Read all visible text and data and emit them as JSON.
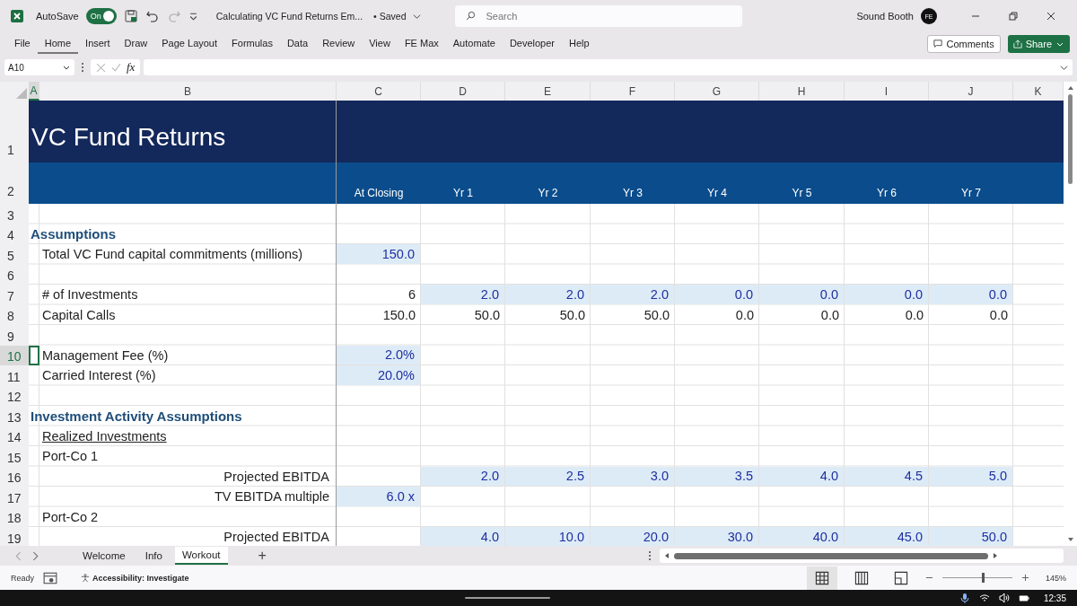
{
  "title_bar": {
    "autosave_label": "AutoSave",
    "autosave": {
      "on": true,
      "label": "On"
    },
    "document_title": "Calculating VC Fund Returns Em...",
    "save_status": "• Saved",
    "search": {
      "placeholder": "Search"
    },
    "user_name": "Sound Booth",
    "avatar_initials": "FE"
  },
  "ribbon_tabs": [
    {
      "label": "File",
      "selected": false
    },
    {
      "label": "Home",
      "selected": true
    },
    {
      "label": "Insert",
      "selected": false
    },
    {
      "label": "Draw",
      "selected": false
    },
    {
      "label": "Page Layout",
      "selected": false
    },
    {
      "label": "Formulas",
      "selected": false
    },
    {
      "label": "Data",
      "selected": false
    },
    {
      "label": "Review",
      "selected": false
    },
    {
      "label": "View",
      "selected": false
    },
    {
      "label": "FE Max",
      "selected": false
    },
    {
      "label": "Automate",
      "selected": false
    },
    {
      "label": "Developer",
      "selected": false
    },
    {
      "label": "Help",
      "selected": false
    }
  ],
  "comments_button": "Comments",
  "share_button": "Share",
  "formula_bar": {
    "name_box": "A10",
    "fx": "fx"
  },
  "sheet": {
    "columns": [
      {
        "label": "A",
        "selected": true
      },
      {
        "label": "B",
        "selected": false
      },
      {
        "label": "C",
        "selected": false
      },
      {
        "label": "D",
        "selected": false
      },
      {
        "label": "E",
        "selected": false
      },
      {
        "label": "F",
        "selected": false
      },
      {
        "label": "G",
        "selected": false
      },
      {
        "label": "H",
        "selected": false
      },
      {
        "label": "I",
        "selected": false
      },
      {
        "label": "J",
        "selected": false
      },
      {
        "label": "K",
        "selected": false
      }
    ],
    "rows": [
      {
        "num": "1",
        "kind": "title",
        "selected": false,
        "label": {
          "kind": "title",
          "text": "VC Fund Returns"
        }
      },
      {
        "num": "2",
        "kind": "header",
        "selected": false,
        "closing": {
          "text": "At Closing",
          "input": false
        },
        "years": [
          {
            "text": "Yr 1",
            "input": false
          },
          {
            "text": "Yr 2",
            "input": false
          },
          {
            "text": "Yr 3",
            "input": false
          },
          {
            "text": "Yr 4",
            "input": false
          },
          {
            "text": "Yr 5",
            "input": false
          },
          {
            "text": "Yr 6",
            "input": false
          },
          {
            "text": "Yr 7",
            "input": false
          }
        ]
      },
      {
        "num": "3",
        "kind": "normal",
        "selected": false
      },
      {
        "num": "4",
        "kind": "normal",
        "selected": false,
        "label": {
          "kind": "section",
          "text": "Assumptions"
        }
      },
      {
        "num": "5",
        "kind": "normal",
        "selected": false,
        "label": {
          "kind": "plain",
          "text": "Total VC Fund capital commitments (millions)"
        },
        "closing": {
          "text": "150.0",
          "input": true
        }
      },
      {
        "num": "6",
        "kind": "normal",
        "selected": false
      },
      {
        "num": "7",
        "kind": "normal",
        "selected": false,
        "label": {
          "kind": "plain",
          "text": "# of Investments"
        },
        "closing": {
          "text": "6",
          "input": false
        },
        "years": [
          {
            "text": "2.0",
            "input": true
          },
          {
            "text": "2.0",
            "input": true
          },
          {
            "text": "2.0",
            "input": true
          },
          {
            "text": "0.0",
            "input": true
          },
          {
            "text": "0.0",
            "input": true
          },
          {
            "text": "0.0",
            "input": true
          },
          {
            "text": "0.0",
            "input": true
          }
        ]
      },
      {
        "num": "8",
        "kind": "normal",
        "selected": false,
        "label": {
          "kind": "plain",
          "text": "Capital Calls"
        },
        "closing": {
          "text": "150.0",
          "input": false
        },
        "years": [
          {
            "text": "50.0",
            "input": false
          },
          {
            "text": "50.0",
            "input": false
          },
          {
            "text": "50.0",
            "input": false
          },
          {
            "text": "0.0",
            "input": false
          },
          {
            "text": "0.0",
            "input": false
          },
          {
            "text": "0.0",
            "input": false
          },
          {
            "text": "0.0",
            "input": false
          }
        ]
      },
      {
        "num": "9",
        "kind": "normal",
        "selected": false
      },
      {
        "num": "10",
        "kind": "normal",
        "selected": true,
        "label": {
          "kind": "plain",
          "text": "Management Fee (%)"
        },
        "closing": {
          "text": "2.0%",
          "input": true
        }
      },
      {
        "num": "11",
        "kind": "normal",
        "selected": false,
        "label": {
          "kind": "plain",
          "text": "Carried Interest (%)"
        },
        "closing": {
          "text": "20.0%",
          "input": true
        }
      },
      {
        "num": "12",
        "kind": "normal",
        "selected": false
      },
      {
        "num": "13",
        "kind": "normal",
        "selected": false,
        "label": {
          "kind": "section",
          "text": "Investment Activity Assumptions"
        }
      },
      {
        "num": "14",
        "kind": "normal",
        "selected": false,
        "label": {
          "kind": "underline",
          "text": "Realized Investments"
        }
      },
      {
        "num": "15",
        "kind": "normal",
        "selected": false,
        "label": {
          "kind": "plain",
          "text": "Port-Co 1"
        }
      },
      {
        "num": "16",
        "kind": "normal",
        "selected": false,
        "label": {
          "kind": "right",
          "text": "Projected EBITDA"
        },
        "years": [
          {
            "text": "2.0",
            "input": true
          },
          {
            "text": "2.5",
            "input": true
          },
          {
            "text": "3.0",
            "input": true
          },
          {
            "text": "3.5",
            "input": true
          },
          {
            "text": "4.0",
            "input": true
          },
          {
            "text": "4.5",
            "input": true
          },
          {
            "text": "5.0",
            "input": true
          }
        ]
      },
      {
        "num": "17",
        "kind": "normal",
        "selected": false,
        "label": {
          "kind": "right",
          "text": "TV EBITDA multiple"
        },
        "closing": {
          "text": "6.0 x",
          "input": true
        }
      },
      {
        "num": "18",
        "kind": "normal",
        "selected": false,
        "label": {
          "kind": "plain",
          "text": "Port-Co 2"
        }
      },
      {
        "num": "19",
        "kind": "normal",
        "selected": false,
        "label": {
          "kind": "right",
          "text": "Projected EBITDA"
        },
        "years": [
          {
            "text": "4.0",
            "input": true
          },
          {
            "text": "10.0",
            "input": true
          },
          {
            "text": "20.0",
            "input": true
          },
          {
            "text": "30.0",
            "input": true
          },
          {
            "text": "40.0",
            "input": true
          },
          {
            "text": "45.0",
            "input": true
          },
          {
            "text": "50.0",
            "input": true
          }
        ]
      }
    ]
  },
  "sheet_tabs": [
    {
      "label": "Welcome",
      "selected": false
    },
    {
      "label": "Info",
      "selected": false
    },
    {
      "label": "Workout",
      "selected": true
    }
  ],
  "add_sheet": "+",
  "status_bar": {
    "ready": "Ready",
    "accessibility": "Accessibility: Investigate",
    "zoom_slider": {
      "level": 0.58
    },
    "zoom": "145%"
  },
  "taskbar": {
    "time": "12:35"
  }
}
